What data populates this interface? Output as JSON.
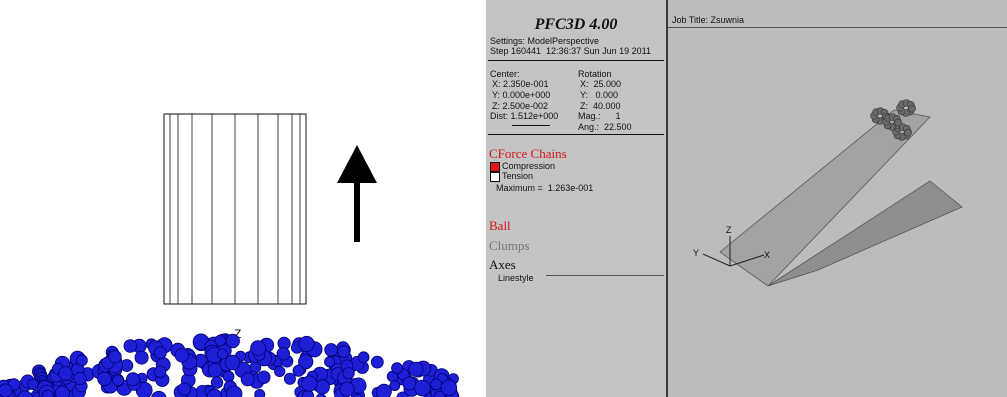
{
  "left_scene": {
    "axis_label": "Z"
  },
  "pfc": {
    "app_title": "PFC3D 4.00",
    "settings_line": "Settings: ModelPerspective",
    "step_line": "Step 160441  12:36:37 Sun Jun 19 2011",
    "center": {
      "heading": "Center:",
      "x": "X: 2.350e-001",
      "y": "Y: 0.000e+000",
      "z": "Z: 2.500e-002",
      "dist": "Dist: 1.512e+000"
    },
    "rotation": {
      "heading": "Rotation",
      "x": "X:  25.000",
      "y": "Y:   0.000",
      "z": "Z:  40.000",
      "mag": "Mag.:      1",
      "ang": "Ang.:  22.500"
    },
    "force_chains": {
      "heading": "CForce Chains",
      "compression": "Compression",
      "tension": "Tension",
      "maximum": "Maximum =  1.263e-001",
      "compression_color": "#e01818",
      "tension_color": "#ffffff"
    },
    "ball_label": "Ball",
    "clumps_label": "Clumps",
    "axes": {
      "heading": "Axes",
      "linestyle": "Linestyle"
    },
    "job_title": "Job Title: Zsuwnia",
    "viewport_axes": {
      "z": "Z",
      "y": "Y",
      "x": "X"
    }
  }
}
